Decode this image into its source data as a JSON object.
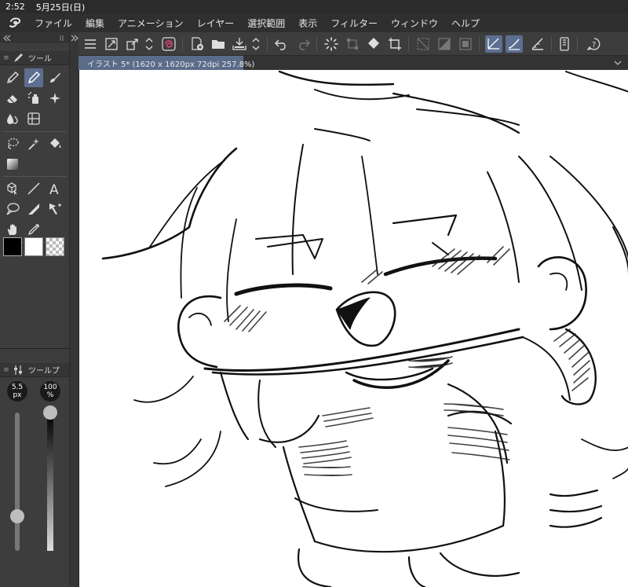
{
  "status": {
    "time": "2:52",
    "date": "5月25日(日)"
  },
  "menu": [
    "ファイル",
    "編集",
    "アニメーション",
    "レイヤー",
    "選択範囲",
    "表示",
    "フィルター",
    "ウィンドウ",
    "ヘルプ"
  ],
  "document_tab": {
    "label": "イラスト 5* (1620 x 1620px 72dpi 257.8%)"
  },
  "tool_panel": {
    "title": "ツール"
  },
  "tool_property_panel": {
    "title": "ツールプ"
  },
  "brush_size": {
    "value": "5.5",
    "unit": "px",
    "level": 0.25
  },
  "opacity": {
    "value": "100",
    "unit": "%",
    "level": 1.0
  },
  "colors": {
    "main": "#000000",
    "sub": "#ffffff",
    "accent": "#5d6f90"
  },
  "icons": {
    "toolbar": [
      "menu-icon",
      "resize-canvas-icon",
      "copy-icon",
      "pen-icon",
      "swirl-icon",
      "new-layer-icon",
      "open-folder-icon",
      "save-icon",
      "up-down-icon",
      "undo-icon",
      "redo-icon",
      "loading-icon",
      "transform-icon",
      "fill-icon",
      "crop-icon",
      "deselect-icon",
      "select-all-icon",
      "invert-selection-icon",
      "vector-eraser-icon",
      "stabilizer-icon",
      "ruler-icon",
      "smartphone-icon",
      "help-icon"
    ],
    "tools": [
      "pen-tool-icon",
      "pencil-tool-icon",
      "brush-tool-icon",
      "eraser-tool-icon",
      "airbrush-tool-icon",
      "decoration-tool-icon",
      "blend-tool-icon",
      "frame-tool-icon",
      "lasso-tool-icon",
      "magic-wand-tool-icon",
      "bucket-tool-icon",
      "gradient-tool-icon",
      "object-tool-icon",
      "line-tool-icon",
      "text-tool-icon",
      "balloon-tool-icon",
      "correct-line-tool-icon",
      "move-tool-icon",
      "hand-tool-icon",
      "eyedropper-tool-icon"
    ]
  }
}
